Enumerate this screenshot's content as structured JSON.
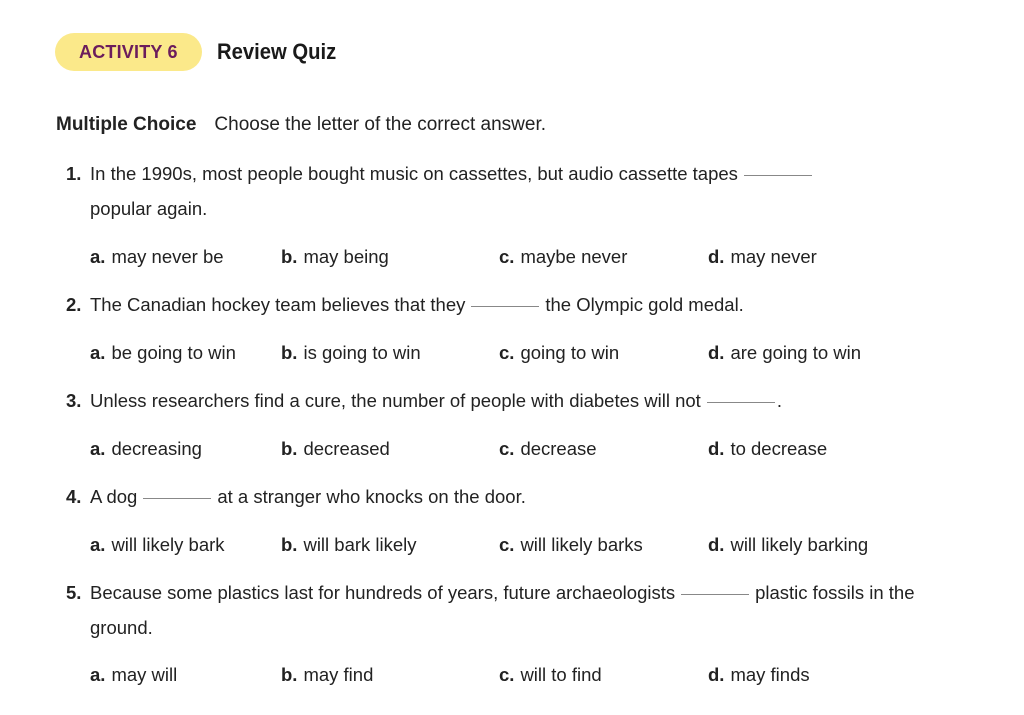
{
  "header": {
    "badge": "ACTIVITY 6",
    "title": "Review Quiz"
  },
  "instructions": {
    "section": "Multiple Choice",
    "text": "Choose the letter of the correct answer."
  },
  "questions": [
    {
      "num": "1.",
      "before": "In the 1990s, most people bought music on cassettes, but audio cassette tapes",
      "after": "",
      "line2": "popular again.",
      "options": [
        {
          "letter": "a.",
          "text": "may never be"
        },
        {
          "letter": "b.",
          "text": "may being"
        },
        {
          "letter": "c.",
          "text": "maybe never"
        },
        {
          "letter": "d.",
          "text": "may never"
        }
      ]
    },
    {
      "num": "2.",
      "before": "The Canadian hockey team believes that they",
      "after": "the Olympic gold medal.",
      "line2": "",
      "options": [
        {
          "letter": "a.",
          "text": "be going to win"
        },
        {
          "letter": "b.",
          "text": "is going to win"
        },
        {
          "letter": "c.",
          "text": "going to win"
        },
        {
          "letter": "d.",
          "text": "are going to win"
        }
      ]
    },
    {
      "num": "3.",
      "before": "Unless researchers find a cure, the number of people with diabetes will not",
      "after": ".",
      "line2": "",
      "options": [
        {
          "letter": "a.",
          "text": "decreasing"
        },
        {
          "letter": "b.",
          "text": "decreased"
        },
        {
          "letter": "c.",
          "text": "decrease"
        },
        {
          "letter": "d.",
          "text": "to decrease"
        }
      ]
    },
    {
      "num": "4.",
      "before": "A dog",
      "after": "at a stranger who knocks on the door.",
      "line2": "",
      "options": [
        {
          "letter": "a.",
          "text": "will likely bark"
        },
        {
          "letter": "b.",
          "text": "will bark likely"
        },
        {
          "letter": "c.",
          "text": "will likely barks"
        },
        {
          "letter": "d.",
          "text": "will likely barking"
        }
      ]
    },
    {
      "num": "5.",
      "before": "Because some plastics last for hundreds of years, future archaeologists",
      "after": "plastic fossils in the",
      "line2": "ground.",
      "options": [
        {
          "letter": "a.",
          "text": "may will"
        },
        {
          "letter": "b.",
          "text": "may find"
        },
        {
          "letter": "c.",
          "text": "will to find"
        },
        {
          "letter": "d.",
          "text": "may finds"
        }
      ]
    }
  ]
}
